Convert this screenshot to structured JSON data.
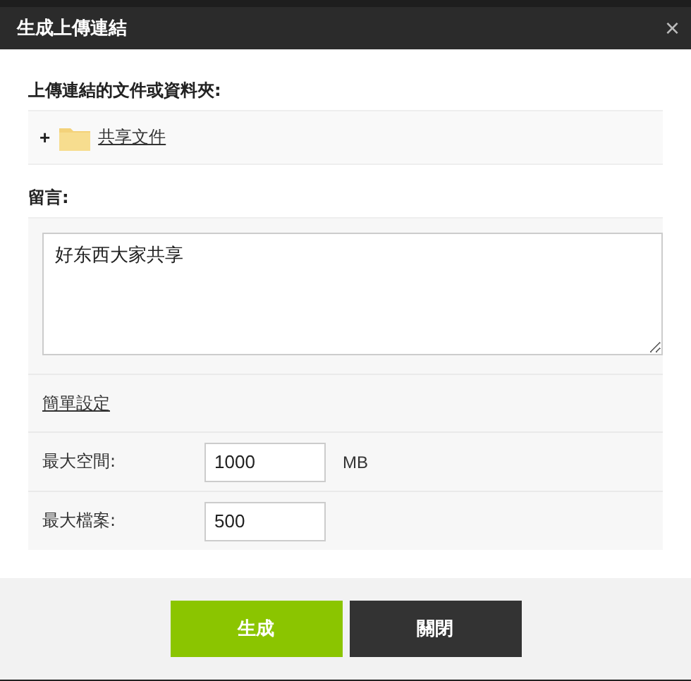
{
  "dialog": {
    "title": "生成上傳連結",
    "close": "×"
  },
  "files": {
    "label": "上傳連結的文件或資料夾:",
    "items": [
      {
        "expand": "+",
        "name": "共享文件"
      }
    ]
  },
  "message": {
    "label": "留言:",
    "value": "好东西大家共享"
  },
  "settings": {
    "link": "簡單設定",
    "rows": [
      {
        "label": "最大空間:",
        "value": "1000",
        "unit": "MB"
      },
      {
        "label": "最大檔案:",
        "value": "500"
      }
    ]
  },
  "buttons": [
    {
      "label": "生成",
      "kind": "primary"
    },
    {
      "label": "關閉",
      "kind": "secondary"
    }
  ]
}
